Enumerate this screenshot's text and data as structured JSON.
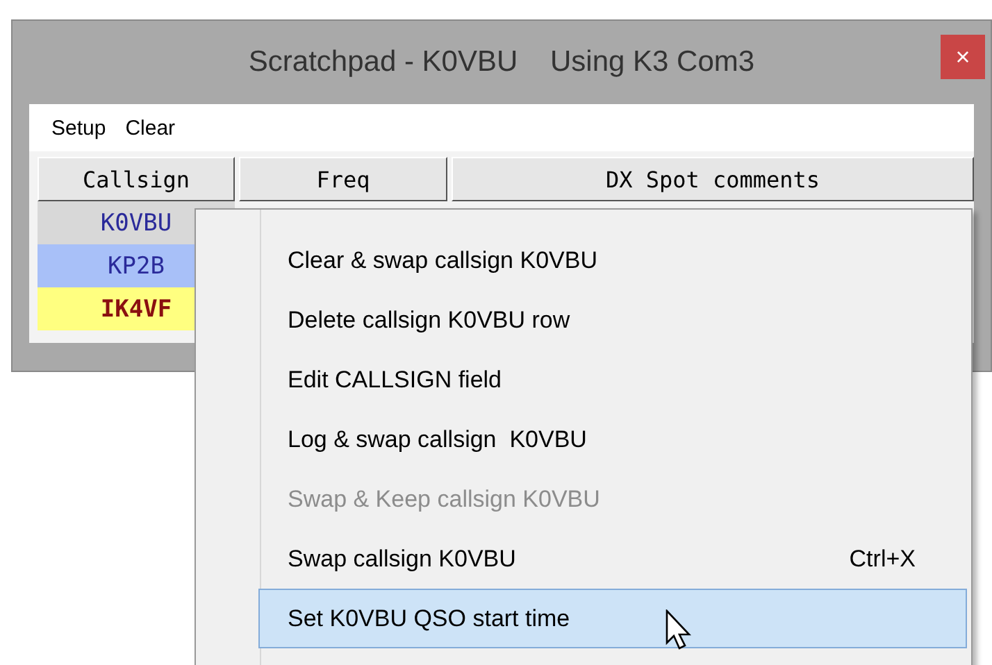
{
  "window": {
    "title": "Scratchpad - K0VBU    Using K3 Com3",
    "close": "×"
  },
  "menu_bar": [
    "Setup",
    "Clear"
  ],
  "table": {
    "columns": [
      "Callsign",
      "Freq",
      "DX Spot comments"
    ],
    "rows": [
      {
        "callsign": "K0VBU",
        "color": "#d8d8d8",
        "kind": "normal"
      },
      {
        "callsign": "KP2B",
        "color": "#a8c0f8",
        "kind": "normal"
      },
      {
        "callsign": "IK4VF",
        "color": "#ffff80",
        "kind": "alert"
      }
    ]
  },
  "context_menu": [
    {
      "label": "Clear & swap callsign K0VBU",
      "disabled": false,
      "selected": false
    },
    {
      "label": "Delete callsign K0VBU row",
      "disabled": false,
      "selected": false
    },
    {
      "label": "Edit CALLSIGN field",
      "disabled": false,
      "selected": false
    },
    {
      "label": "Log & swap callsign  K0VBU",
      "disabled": false,
      "selected": false
    },
    {
      "label": "Swap & Keep callsign K0VBU",
      "disabled": true,
      "selected": false
    },
    {
      "label": "Swap callsign K0VBU",
      "shortcut": "Ctrl+X",
      "disabled": false,
      "selected": false
    },
    {
      "label": "Set K0VBU QSO start time",
      "disabled": false,
      "selected": true
    }
  ]
}
